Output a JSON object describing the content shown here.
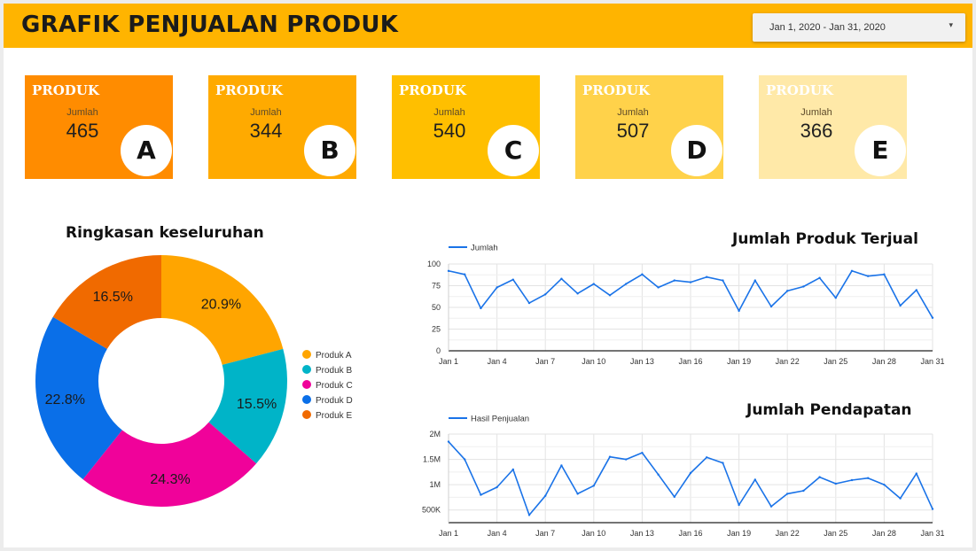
{
  "header": {
    "title": "GRAFIK PENJUALAN PRODUK",
    "date_range": "Jan 1, 2020 - Jan 31, 2020",
    "accent_color": "#ffb400"
  },
  "cards": [
    {
      "title": "PRODUK",
      "sublabel": "Jumlah",
      "value": "465",
      "letter": "A",
      "color": "#ff8c00"
    },
    {
      "title": "PRODUK",
      "sublabel": "Jumlah",
      "value": "344",
      "letter": "B",
      "color": "#ffaa00"
    },
    {
      "title": "PRODUK",
      "sublabel": "Jumlah",
      "value": "540",
      "letter": "C",
      "color": "#ffbf00"
    },
    {
      "title": "PRODUK",
      "sublabel": "Jumlah",
      "value": "507",
      "letter": "D",
      "color": "#ffd24a"
    },
    {
      "title": "PRODUK",
      "sublabel": "Jumlah",
      "value": "366",
      "letter": "E",
      "color": "#ffe9a8"
    }
  ],
  "chart_data": [
    {
      "type": "pie",
      "title": "Ringkasan keseluruhan",
      "categories": [
        "Produk A",
        "Produk B",
        "Produk C",
        "Produk D",
        "Produk E"
      ],
      "values": [
        20.9,
        15.5,
        24.3,
        22.8,
        16.5
      ],
      "labels": [
        "20.9%",
        "15.5%",
        "24.3%",
        "22.8%",
        "16.5%"
      ],
      "colors": [
        "#ffa500",
        "#00b4c8",
        "#f0029a",
        "#0a6fe8",
        "#f06a00"
      ],
      "legend": "right",
      "donut": true
    },
    {
      "type": "line",
      "title": "Jumlah Produk Terjual",
      "legend": "top-left",
      "grid": true,
      "x": [
        "Jan 1",
        "Jan 2",
        "Jan 3",
        "Jan 4",
        "Jan 5",
        "Jan 6",
        "Jan 7",
        "Jan 8",
        "Jan 9",
        "Jan 10",
        "Jan 11",
        "Jan 12",
        "Jan 13",
        "Jan 14",
        "Jan 15",
        "Jan 16",
        "Jan 17",
        "Jan 18",
        "Jan 19",
        "Jan 20",
        "Jan 21",
        "Jan 22",
        "Jan 23",
        "Jan 24",
        "Jan 25",
        "Jan 26",
        "Jan 27",
        "Jan 28",
        "Jan 29",
        "Jan 30",
        "Jan 31"
      ],
      "xticks": [
        "Jan 1",
        "Jan 4",
        "Jan 7",
        "Jan 10",
        "Jan 13",
        "Jan 16",
        "Jan 19",
        "Jan 22",
        "Jan 25",
        "Jan 28",
        "Jan 31"
      ],
      "yticks": [
        "0",
        "25",
        "50",
        "75",
        "100"
      ],
      "ylim": [
        0,
        100
      ],
      "series": [
        {
          "name": "Jumlah",
          "color": "#1a73e8",
          "values": [
            92,
            88,
            49,
            73,
            82,
            55,
            65,
            83,
            66,
            77,
            64,
            77,
            88,
            73,
            81,
            79,
            85,
            81,
            46,
            81,
            51,
            69,
            74,
            84,
            61,
            92,
            86,
            88,
            52,
            70,
            38
          ]
        }
      ]
    },
    {
      "type": "line",
      "title": "Jumlah Pendapatan",
      "legend": "top-left",
      "grid": true,
      "x": [
        "Jan 1",
        "Jan 2",
        "Jan 3",
        "Jan 4",
        "Jan 5",
        "Jan 6",
        "Jan 7",
        "Jan 8",
        "Jan 9",
        "Jan 10",
        "Jan 11",
        "Jan 12",
        "Jan 13",
        "Jan 14",
        "Jan 15",
        "Jan 16",
        "Jan 17",
        "Jan 18",
        "Jan 19",
        "Jan 20",
        "Jan 21",
        "Jan 22",
        "Jan 23",
        "Jan 24",
        "Jan 25",
        "Jan 26",
        "Jan 27",
        "Jan 28",
        "Jan 29",
        "Jan 30",
        "Jan 31"
      ],
      "xticks": [
        "Jan 1",
        "Jan 4",
        "Jan 7",
        "Jan 10",
        "Jan 13",
        "Jan 16",
        "Jan 19",
        "Jan 22",
        "Jan 25",
        "Jan 28",
        "Jan 31"
      ],
      "yticks": [
        "500K",
        "1M",
        "1.5M",
        "2M"
      ],
      "ytick_values": [
        500000,
        1000000,
        1500000,
        2000000
      ],
      "ylim": [
        250000,
        2000000
      ],
      "series": [
        {
          "name": "Hasil Penjualan",
          "color": "#1a73e8",
          "values": [
            1850000,
            1500000,
            800000,
            950000,
            1300000,
            400000,
            780000,
            1380000,
            820000,
            980000,
            1550000,
            1500000,
            1630000,
            1200000,
            760000,
            1230000,
            1540000,
            1430000,
            600000,
            1100000,
            570000,
            820000,
            880000,
            1150000,
            1020000,
            1090000,
            1130000,
            1000000,
            730000,
            1220000,
            520000
          ]
        }
      ]
    }
  ]
}
